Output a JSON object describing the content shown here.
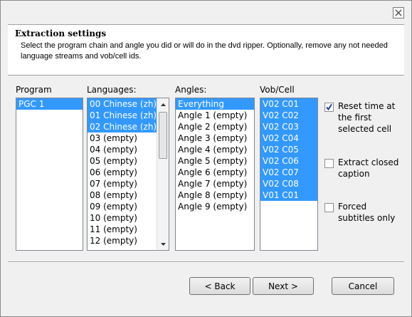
{
  "header": {
    "title": "Extraction settings",
    "description": "Select the program chain and angle you did or will do in the dvd ripper. Optionally, remove any not needed language streams and vob/cell ids."
  },
  "program": {
    "label": "Program",
    "items": [
      {
        "text": "PGC 1",
        "selected": true
      }
    ]
  },
  "languages": {
    "label": "Languages:",
    "items": [
      {
        "text": "00 Chinese (zh)",
        "selected": true
      },
      {
        "text": "01 Chinese (zh)",
        "selected": true
      },
      {
        "text": "02 Chinese (zh)",
        "selected": true
      },
      {
        "text": "03 (empty)",
        "selected": false
      },
      {
        "text": "04 (empty)",
        "selected": false
      },
      {
        "text": "05 (empty)",
        "selected": false
      },
      {
        "text": "06 (empty)",
        "selected": false
      },
      {
        "text": "07 (empty)",
        "selected": false
      },
      {
        "text": "08 (empty)",
        "selected": false
      },
      {
        "text": "09 (empty)",
        "selected": false
      },
      {
        "text": "10 (empty)",
        "selected": false
      },
      {
        "text": "11 (empty)",
        "selected": false
      },
      {
        "text": "12 (empty)",
        "selected": false
      }
    ]
  },
  "angles": {
    "label": "Angles:",
    "items": [
      {
        "text": "Everything",
        "selected": true
      },
      {
        "text": "Angle 1 (empty)",
        "selected": false
      },
      {
        "text": "Angle 2 (empty)",
        "selected": false
      },
      {
        "text": "Angle 3 (empty)",
        "selected": false
      },
      {
        "text": "Angle 4 (empty)",
        "selected": false
      },
      {
        "text": "Angle 5 (empty)",
        "selected": false
      },
      {
        "text": "Angle 6 (empty)",
        "selected": false
      },
      {
        "text": "Angle 7 (empty)",
        "selected": false
      },
      {
        "text": "Angle 8 (empty)",
        "selected": false
      },
      {
        "text": "Angle 9 (empty)",
        "selected": false
      }
    ]
  },
  "vobcell": {
    "label": "Vob/Cell",
    "items": [
      {
        "text": "V02 C01",
        "selected": true
      },
      {
        "text": "V02 C02",
        "selected": true
      },
      {
        "text": "V02 C03",
        "selected": true
      },
      {
        "text": "V02 C04",
        "selected": true
      },
      {
        "text": "V02 C05",
        "selected": true
      },
      {
        "text": "V02 C06",
        "selected": true
      },
      {
        "text": "V02 C07",
        "selected": true
      },
      {
        "text": "V02 C08",
        "selected": true
      },
      {
        "text": "V01 C01",
        "selected": true
      }
    ]
  },
  "options": {
    "reset_time": {
      "label": "Reset time at the first selected cell",
      "checked": true
    },
    "closed_caption": {
      "label": "Extract closed caption",
      "checked": false
    },
    "forced_subs": {
      "label": "Forced subtitles only",
      "checked": false
    }
  },
  "buttons": {
    "back_label": "< Back",
    "next_label": "Next >",
    "cancel_label": "Cancel"
  },
  "colors": {
    "selection": "#3399ff"
  }
}
